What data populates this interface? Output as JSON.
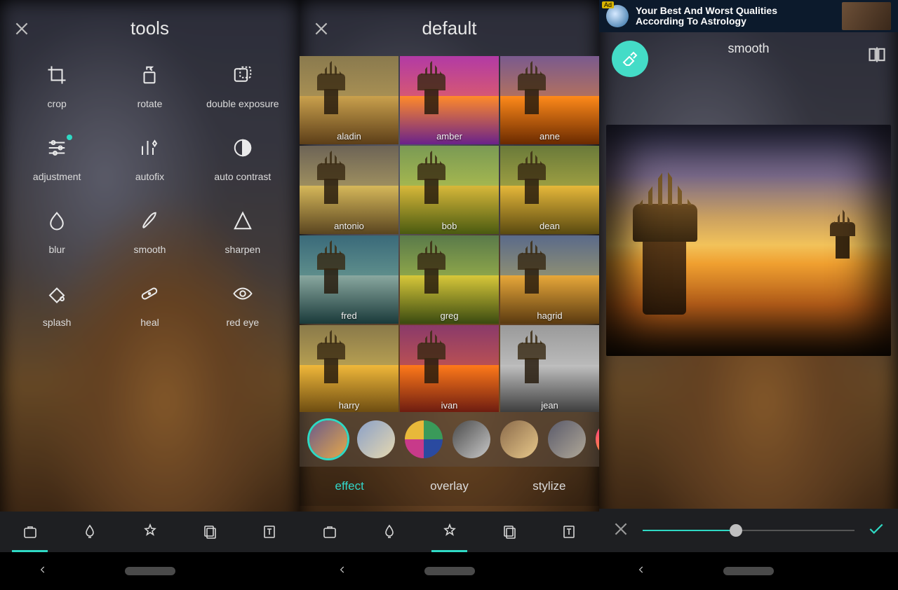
{
  "panel1": {
    "title": "tools",
    "tools": [
      {
        "id": "crop",
        "label": "crop"
      },
      {
        "id": "rotate",
        "label": "rotate"
      },
      {
        "id": "double-exposure",
        "label": "double exposure"
      },
      {
        "id": "adjustment",
        "label": "adjustment",
        "badge": true
      },
      {
        "id": "autofix",
        "label": "autofix"
      },
      {
        "id": "auto-contrast",
        "label": "auto contrast"
      },
      {
        "id": "blur",
        "label": "blur"
      },
      {
        "id": "smooth",
        "label": "smooth"
      },
      {
        "id": "sharpen",
        "label": "sharpen"
      },
      {
        "id": "splash",
        "label": "splash"
      },
      {
        "id": "heal",
        "label": "heal"
      },
      {
        "id": "red-eye",
        "label": "red eye"
      }
    ],
    "bottom_nav": [
      "tools",
      "brush",
      "effects",
      "layers",
      "text"
    ],
    "bottom_active_index": 0
  },
  "panel2": {
    "title": "default",
    "filters": [
      {
        "name": "aladin",
        "sky": [
          "#8a7a4e",
          "#c9a85a"
        ],
        "ground": [
          "#caa14d",
          "#5c3e18"
        ]
      },
      {
        "name": "amber",
        "sky": [
          "#b23aa5",
          "#ff7a3a"
        ],
        "ground": [
          "#ff8a2a",
          "#6a228a"
        ]
      },
      {
        "name": "anne",
        "sky": [
          "#7a5a8e",
          "#f08a2a"
        ],
        "ground": [
          "#ff8a1a",
          "#6a2a00"
        ]
      },
      {
        "name": "antonio",
        "sky": [
          "#6d6456",
          "#d6c06a"
        ],
        "ground": [
          "#d6b85a",
          "#5a4520"
        ]
      },
      {
        "name": "bob",
        "sky": [
          "#7a9a54",
          "#d6d84a"
        ],
        "ground": [
          "#d8b83a",
          "#4a5a10"
        ]
      },
      {
        "name": "dean",
        "sky": [
          "#6a7a3a",
          "#d6c84a"
        ],
        "ground": [
          "#e6b83a",
          "#5a4a10"
        ]
      },
      {
        "name": "fred",
        "sky": [
          "#3a6a7a",
          "#88b8a0"
        ],
        "ground": [
          "#8aa8a0",
          "#1a3a3a"
        ]
      },
      {
        "name": "greg",
        "sky": [
          "#5a7a4a",
          "#c8d84a"
        ],
        "ground": [
          "#d8c83a",
          "#3a4a10"
        ]
      },
      {
        "name": "hagrid",
        "sky": [
          "#5a6a8a",
          "#c8b85a"
        ],
        "ground": [
          "#e8a83a",
          "#5a3a10"
        ]
      },
      {
        "name": "harry",
        "sky": [
          "#8a7a4a",
          "#e8c85a"
        ],
        "ground": [
          "#f0b83a",
          "#6a4a10"
        ]
      },
      {
        "name": "ivan",
        "sky": [
          "#8a3a6a",
          "#f06a3a"
        ],
        "ground": [
          "#ff7a1a",
          "#6a1a10"
        ]
      },
      {
        "name": "jean",
        "sky": [
          "#9a9a9a",
          "#e0e0e0"
        ],
        "ground": [
          "#c0c0c0",
          "#3a3a3a"
        ]
      }
    ],
    "peek_row_colors": [
      [
        "#5a4a9a",
        "#a06ae0"
      ],
      [
        "#6a6a8a",
        "#c0c0d0"
      ],
      [
        "#8a6a3a",
        "#e8b85a"
      ]
    ],
    "categories": [
      {
        "id": "default",
        "selected": true,
        "grad": [
          "#6a5a8a",
          "#e6a84a"
        ]
      },
      {
        "id": "soft",
        "grad": [
          "#8aa0c8",
          "#e6d8b0"
        ]
      },
      {
        "id": "pop",
        "quad": [
          "#3a9a5a",
          "#2a4aa0",
          "#c83a8a",
          "#e8b83a"
        ]
      },
      {
        "id": "bw",
        "grad": [
          "#4a4a4a",
          "#c8c8c8"
        ]
      },
      {
        "id": "warm",
        "grad": [
          "#8a6a4a",
          "#e8c88a"
        ]
      },
      {
        "id": "cool",
        "grad": [
          "#5a5a6a",
          "#b0a898"
        ]
      },
      {
        "id": "neon",
        "grad": [
          "#ff2a8a",
          "#ffcc1a"
        ],
        "half": true
      }
    ],
    "tabs": [
      {
        "id": "effect",
        "label": "effect",
        "active": true
      },
      {
        "id": "overlay",
        "label": "overlay"
      },
      {
        "id": "stylize",
        "label": "stylize"
      }
    ],
    "bottom_nav": [
      "tools",
      "brush",
      "effects",
      "layers",
      "text"
    ],
    "bottom_active_index": 2
  },
  "panel3": {
    "ad": {
      "tag": "Ad",
      "line1": "Your Best And Worst Qualities",
      "line2": "According To Astrology"
    },
    "title": "smooth",
    "slider_percent": 44
  },
  "accent": "#2fd9c4"
}
